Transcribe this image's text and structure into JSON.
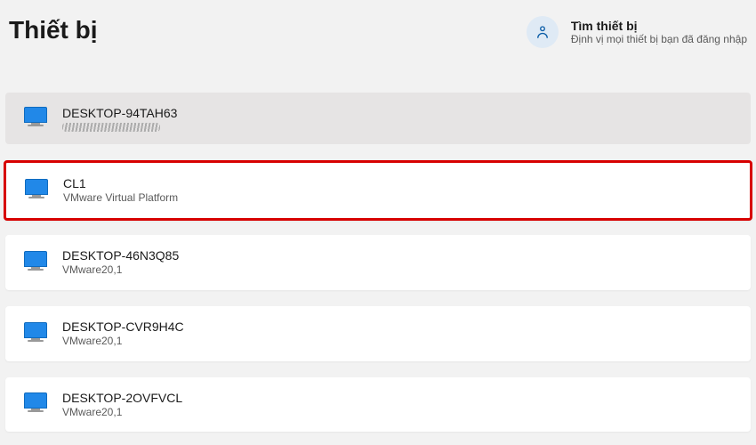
{
  "header": {
    "title": "Thiết bị",
    "find_device": {
      "title": "Tìm thiết bị",
      "subtitle": "Định vị mọi thiết bị bạn đã đăng nhập"
    }
  },
  "devices": [
    {
      "name": "DESKTOP-94TAH63",
      "sub": ""
    },
    {
      "name": "CL1",
      "sub": "VMware Virtual Platform"
    },
    {
      "name": "DESKTOP-46N3Q85",
      "sub": "VMware20,1"
    },
    {
      "name": "DESKTOP-CVR9H4C",
      "sub": "VMware20,1"
    },
    {
      "name": "DESKTOP-2OVFVCL",
      "sub": "VMware20,1"
    }
  ]
}
